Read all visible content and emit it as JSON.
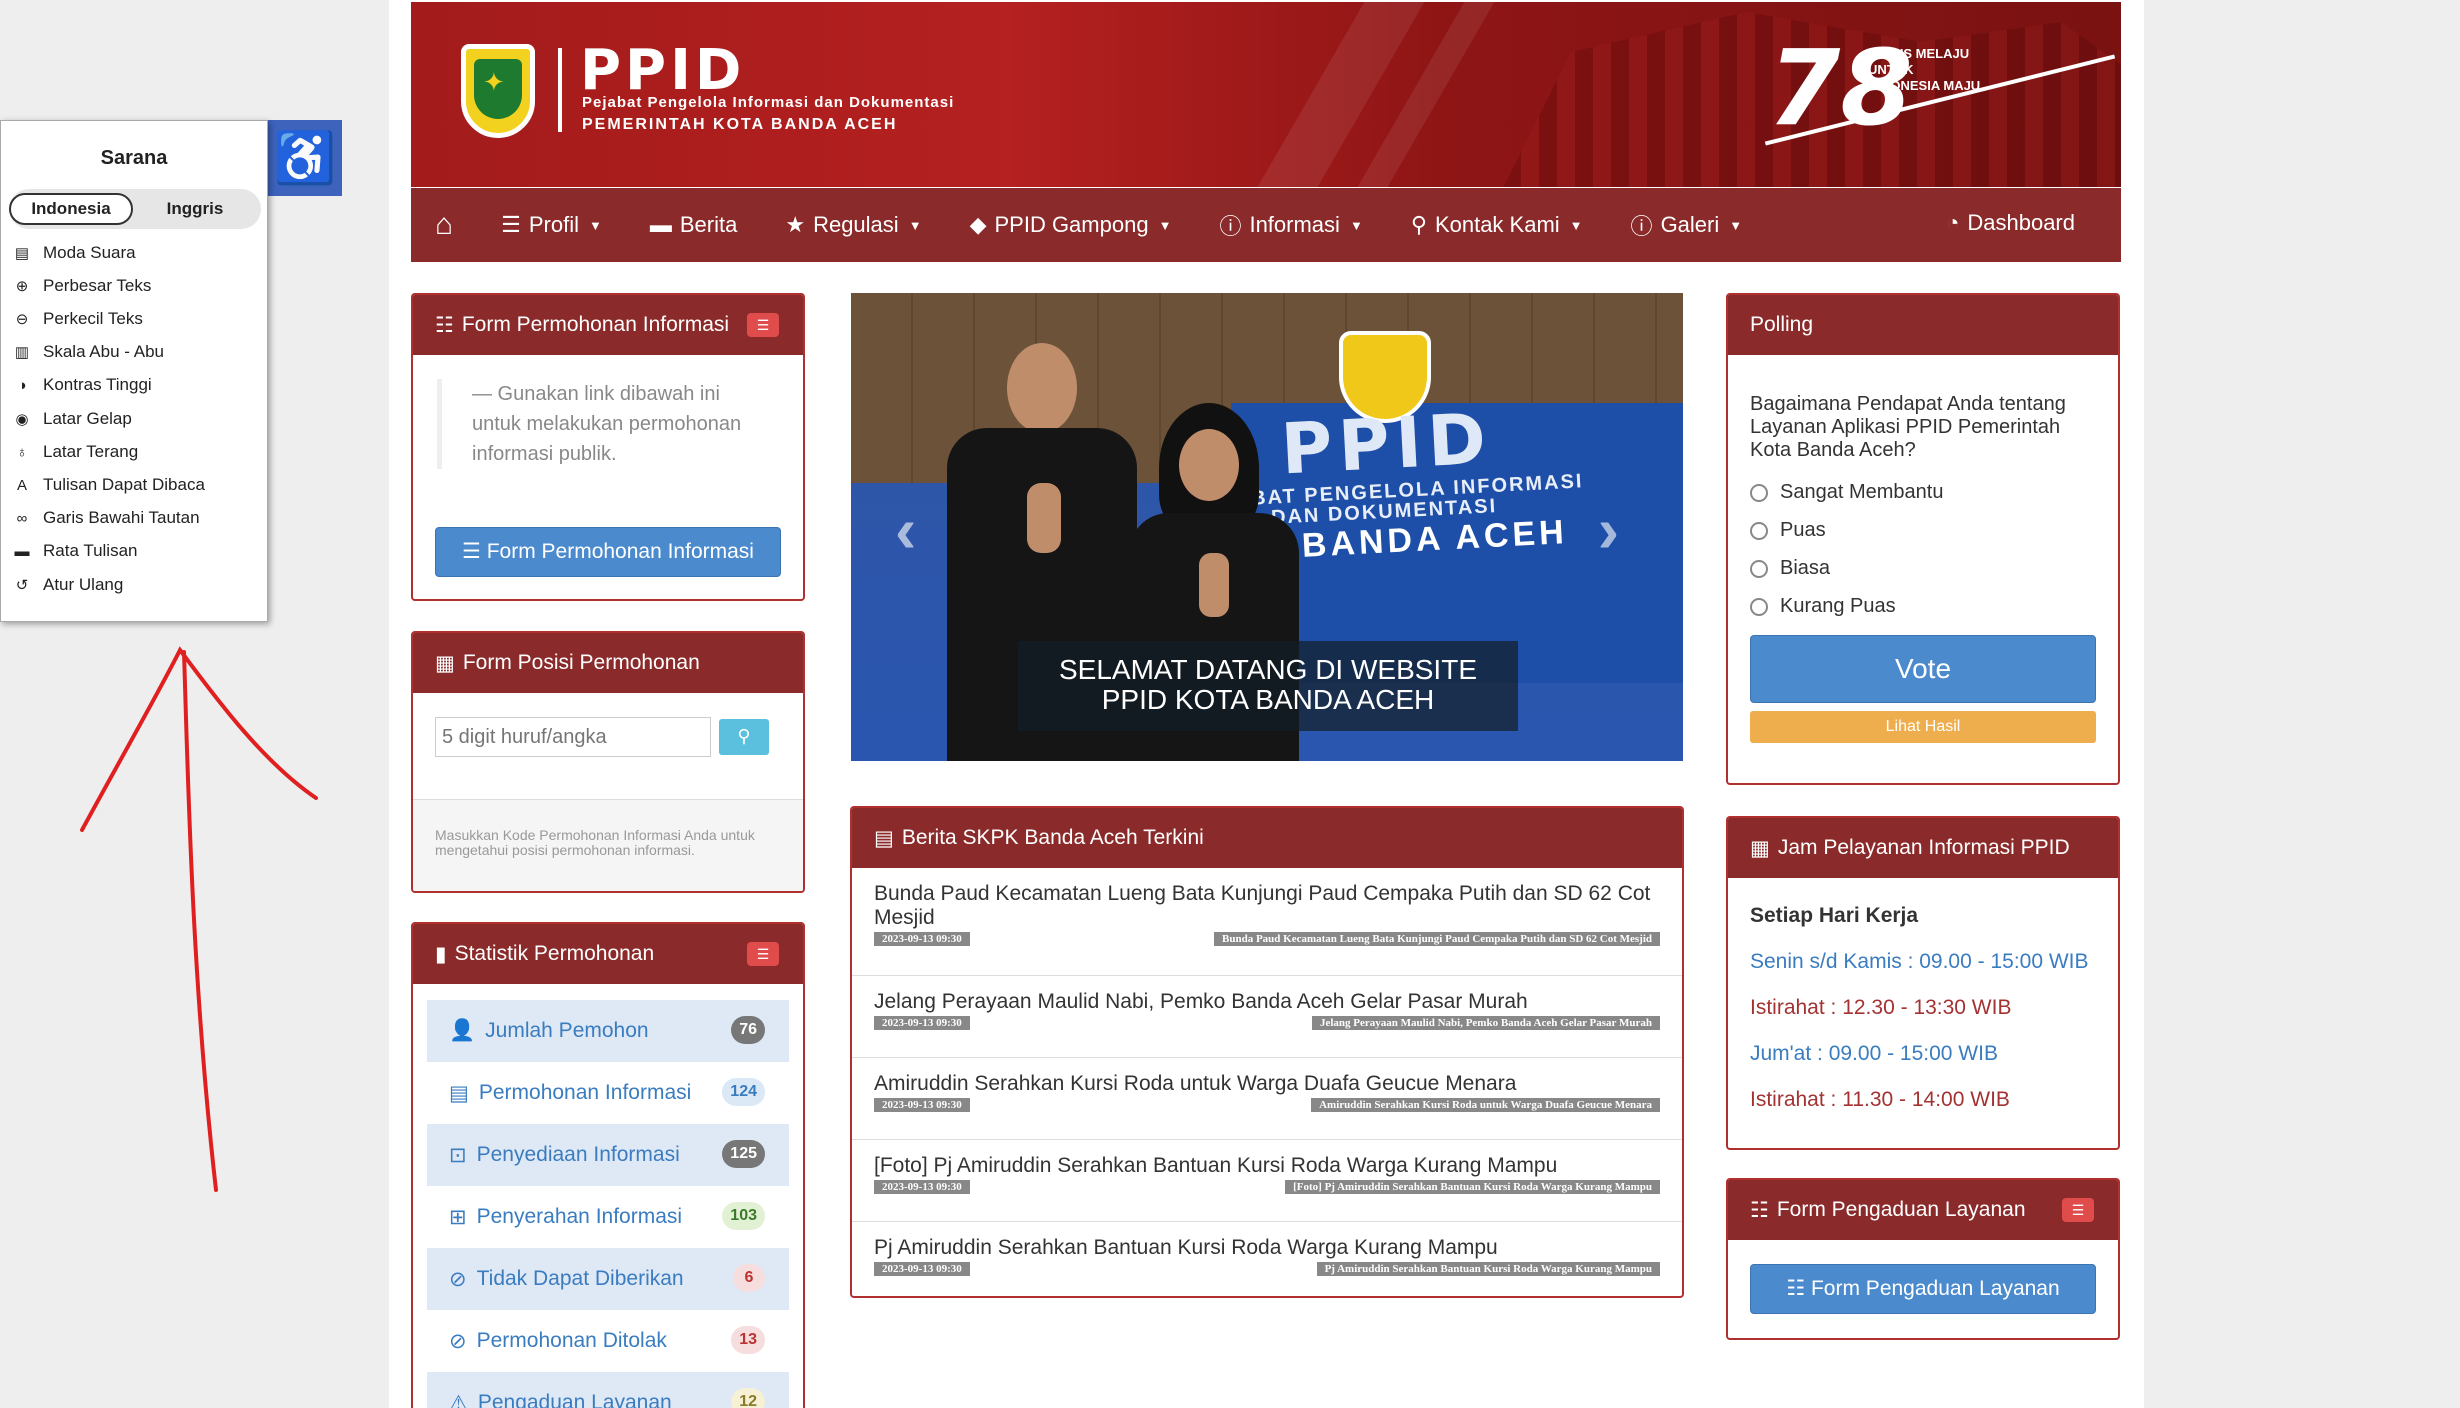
{
  "header": {
    "brand": "PPID",
    "sub1": "Pejabat Pengelola Informasi dan Dokumentasi",
    "sub2": "PEMERINTAH KOTA BANDA ACEH",
    "anniversary": "78",
    "tagline": "TERUS MELAJU UNTUK INDONESIA MAJU"
  },
  "nav": {
    "items": [
      {
        "label": "Profil",
        "icon": "list-icon"
      },
      {
        "label": "Berita",
        "icon": "comment-icon"
      },
      {
        "label": "Regulasi",
        "icon": "star-icon"
      },
      {
        "label": "PPID Gampong",
        "icon": "tag-icon"
      },
      {
        "label": "Informasi",
        "icon": "info-icon"
      },
      {
        "label": "Kontak Kami",
        "icon": "map-marker-icon"
      },
      {
        "label": "Galeri",
        "icon": "info-icon"
      }
    ],
    "dashboard": "Dashboard"
  },
  "form_permohonan": {
    "title": "Form Permohonan Informasi",
    "quote": "— Gunakan link dibawah ini untuk melakukan permohonan informasi publik.",
    "button": "Form Permohonan Informasi"
  },
  "form_posisi": {
    "title": "Form Posisi Permohonan",
    "placeholder": "5 digit huruf/angka",
    "note": "Masukkan Kode Permohonan Informasi Anda untuk mengetahui posisi permohonan informasi."
  },
  "statistik": {
    "title": "Statistik Permohonan",
    "rows": [
      {
        "label": "Jumlah Pemohon",
        "count": "76"
      },
      {
        "label": "Permohonan Informasi",
        "count": "124"
      },
      {
        "label": "Penyediaan Informasi",
        "count": "125"
      },
      {
        "label": "Penyerahan Informasi",
        "count": "103"
      },
      {
        "label": "Tidak Dapat Diberikan",
        "count": "6"
      },
      {
        "label": "Permohonan Ditolak",
        "count": "13"
      },
      {
        "label": "Pengaduan Layanan",
        "count": "12"
      }
    ]
  },
  "carousel": {
    "sign_main": "PPID",
    "sign_sub1": "BAT PENGELOLA INFORMASI",
    "sign_sub2": "DAN DOKUMENTASI",
    "sign_sub3": "A BANDA ACEH",
    "caption1": "SELAMAT DATANG DI WEBSITE",
    "caption2": "PPID KOTA BANDA ACEH"
  },
  "berita": {
    "title": "Berita SKPK Banda Aceh Terkini",
    "items": [
      {
        "title": "Bunda Paud Kecamatan Lueng Bata Kunjungi Paud Cempaka Putih dan SD 62 Cot Mesjid",
        "date": "2023-09-13 09:30",
        "slug": "Bunda Paud Kecamatan Lueng Bata Kunjungi Paud Cempaka Putih dan SD 62 Cot Mesjid"
      },
      {
        "title": "Jelang Perayaan Maulid Nabi, Pemko Banda Aceh Gelar Pasar Murah",
        "date": "2023-09-13 09:30",
        "slug": "Jelang Perayaan Maulid Nabi, Pemko Banda Aceh Gelar Pasar Murah"
      },
      {
        "title": "Amiruddin Serahkan Kursi Roda untuk Warga Duafa Geucue Menara",
        "date": "2023-09-13 09:30",
        "slug": "Amiruddin Serahkan Kursi Roda untuk Warga Duafa Geucue Menara"
      },
      {
        "title": "[Foto] Pj Amiruddin Serahkan Bantuan Kursi Roda Warga Kurang Mampu",
        "date": "2023-09-13 09:30",
        "slug": "[Foto] Pj Amiruddin Serahkan Bantuan Kursi Roda Warga Kurang Mampu"
      },
      {
        "title": "Pj Amiruddin Serahkan Bantuan Kursi Roda Warga Kurang Mampu",
        "date": "2023-09-13 09:30",
        "slug": "Pj Amiruddin Serahkan Bantuan Kursi Roda Warga Kurang Mampu"
      }
    ]
  },
  "polling": {
    "title": "Polling",
    "question": "Bagaimana Pendapat Anda tentang Layanan Aplikasi PPID Pemerintah Kota Banda Aceh?",
    "options": [
      "Sangat Membantu",
      "Puas",
      "Biasa",
      "Kurang Puas"
    ],
    "vote": "Vote",
    "result": "Lihat Hasil"
  },
  "jam": {
    "title": "Jam Pelayanan Informasi PPID",
    "heading": "Setiap Hari Kerja",
    "lines": [
      {
        "text": "Senin s/d Kamis : 09.00 - 15:00 WIB",
        "color": "#3a7cc0"
      },
      {
        "text": "Istirahat : 12.30 - 13:30 WIB",
        "color": "#a33232"
      },
      {
        "text": "Jum'at : 09.00 - 15:00 WIB",
        "color": "#3a7cc0"
      },
      {
        "text": "Istirahat : 11.30 - 14:00 WIB",
        "color": "#a33232"
      }
    ]
  },
  "pengaduan": {
    "title": "Form Pengaduan Layanan",
    "button": "Form Pengaduan Layanan"
  },
  "accessibility": {
    "title": "Sarana",
    "lang_active": "Indonesia",
    "lang_other": "Inggris",
    "items": [
      {
        "label": "Moda Suara",
        "icon": "document-sound-icon"
      },
      {
        "label": "Perbesar Teks",
        "icon": "zoom-in-icon"
      },
      {
        "label": "Perkecil Teks",
        "icon": "zoom-out-icon"
      },
      {
        "label": "Skala Abu - Abu",
        "icon": "barcode-icon"
      },
      {
        "label": "Kontras Tinggi",
        "icon": "contrast-icon"
      },
      {
        "label": "Latar Gelap",
        "icon": "eye-icon"
      },
      {
        "label": "Latar Terang",
        "icon": "bulb-icon"
      },
      {
        "label": "Tulisan Dapat Dibaca",
        "icon": "font-icon"
      },
      {
        "label": "Garis Bawahi Tautan",
        "icon": "link-icon"
      },
      {
        "label": "Rata Tulisan",
        "icon": "comment-icon"
      },
      {
        "label": "Atur Ulang",
        "icon": "reset-icon"
      }
    ]
  },
  "colors": {
    "primary": "#8b2a2a",
    "link": "#3a7cc0",
    "button": "#4a8acd",
    "annotation": "#e02020"
  }
}
